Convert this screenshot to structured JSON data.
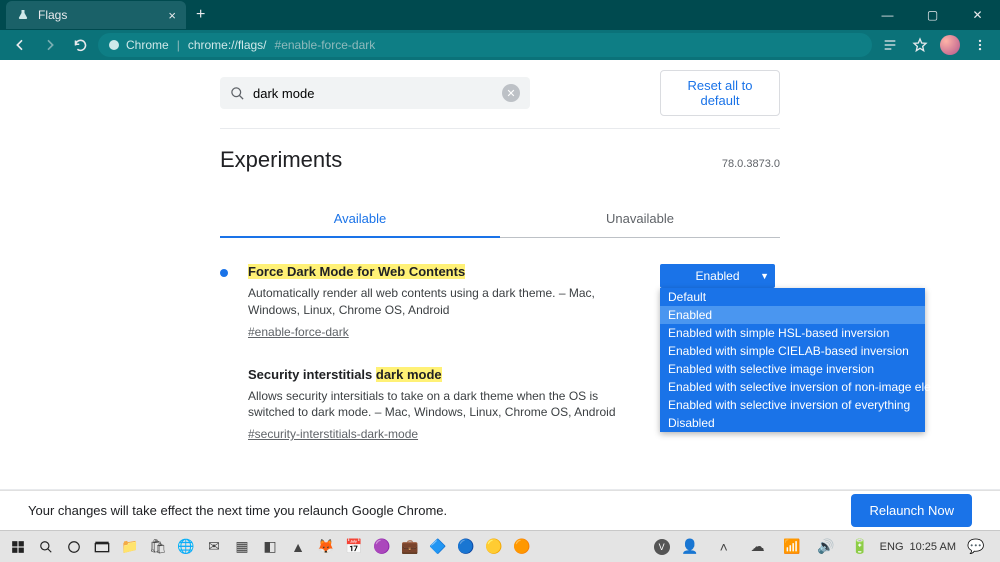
{
  "window": {
    "tab_title": "Flags",
    "controls": {
      "min": "—",
      "max": "▢",
      "close": "✕"
    }
  },
  "toolbar": {
    "chip_label": "Chrome",
    "url_main": "chrome://flags/",
    "url_frag": "#enable-force-dark"
  },
  "search": {
    "value": "dark mode",
    "reset_label": "Reset all to default"
  },
  "header": {
    "title": "Experiments",
    "version": "78.0.3873.0"
  },
  "tabs": {
    "available": "Available",
    "unavailable": "Unavailable"
  },
  "flags": [
    {
      "title_pre": "",
      "title_hl": "Force Dark Mode for Web Contents",
      "title_post": "",
      "desc": "Automatically render all web contents using a dark theme. – Mac, Windows, Linux, Chrome OS, Android",
      "anchor": "#enable-force-dark",
      "has_dot": true,
      "selected": "Enabled",
      "options": [
        "Default",
        "Enabled",
        "Enabled with simple HSL-based inversion",
        "Enabled with simple CIELAB-based inversion",
        "Enabled with selective image inversion",
        "Enabled with selective inversion of non-image elements",
        "Enabled with selective inversion of everything",
        "Disabled"
      ]
    },
    {
      "title_pre": "Security interstitials ",
      "title_hl": "dark mode",
      "title_post": "",
      "desc": "Allows security intersitials to take on a dark theme when the OS is switched to dark mode. – Mac, Windows, Linux, Chrome OS, Android",
      "anchor": "#security-interstitials-dark-mode",
      "has_dot": false
    }
  ],
  "footer": {
    "message": "Your changes will take effect the next time you relaunch Google Chrome.",
    "relaunch": "Relaunch Now"
  },
  "tray": {
    "lang": "ENG",
    "time": "10:25 AM"
  }
}
